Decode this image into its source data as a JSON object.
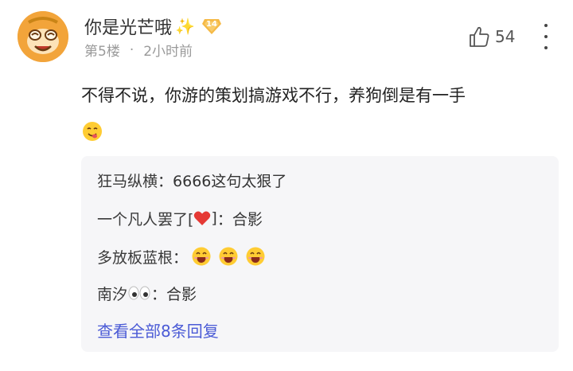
{
  "comment": {
    "username": "你是光芒哦",
    "sparkle": "✨",
    "level": "14",
    "floor": "第5楼",
    "separator": "·",
    "time": "2小时前",
    "like_count": "54",
    "text": "不得不说，你游的策划搞游戏不行，养狗倒是有一手",
    "icons": [
      "avatar-monkey",
      "sparkle-icon",
      "level-badge-icon",
      "thumbs-up-icon",
      "more-icon",
      "yum-face-emoji"
    ]
  },
  "replies": [
    {
      "author": "狂马纵横",
      "colon": "：",
      "text": "6666这句太狠了"
    },
    {
      "author_prefix": "一个凡人罢了[",
      "author_suffix": "]",
      "colon": "：",
      "text": "合影",
      "icon": "heart-icon"
    },
    {
      "author": "多放板蓝根",
      "colon": "：",
      "text": "",
      "icon": "grinning-face-emoji"
    },
    {
      "author": "南汐",
      "colon": "：",
      "text": "合影",
      "icon": "eyes-emoji"
    }
  ],
  "view_all_label": "查看全部8条回复",
  "colors": {
    "link": "#4b5bd6",
    "avatar": "#f3a63b",
    "badge": "#f5b945",
    "heart": "#e53935",
    "reply_bg": "#f6f6f8"
  }
}
